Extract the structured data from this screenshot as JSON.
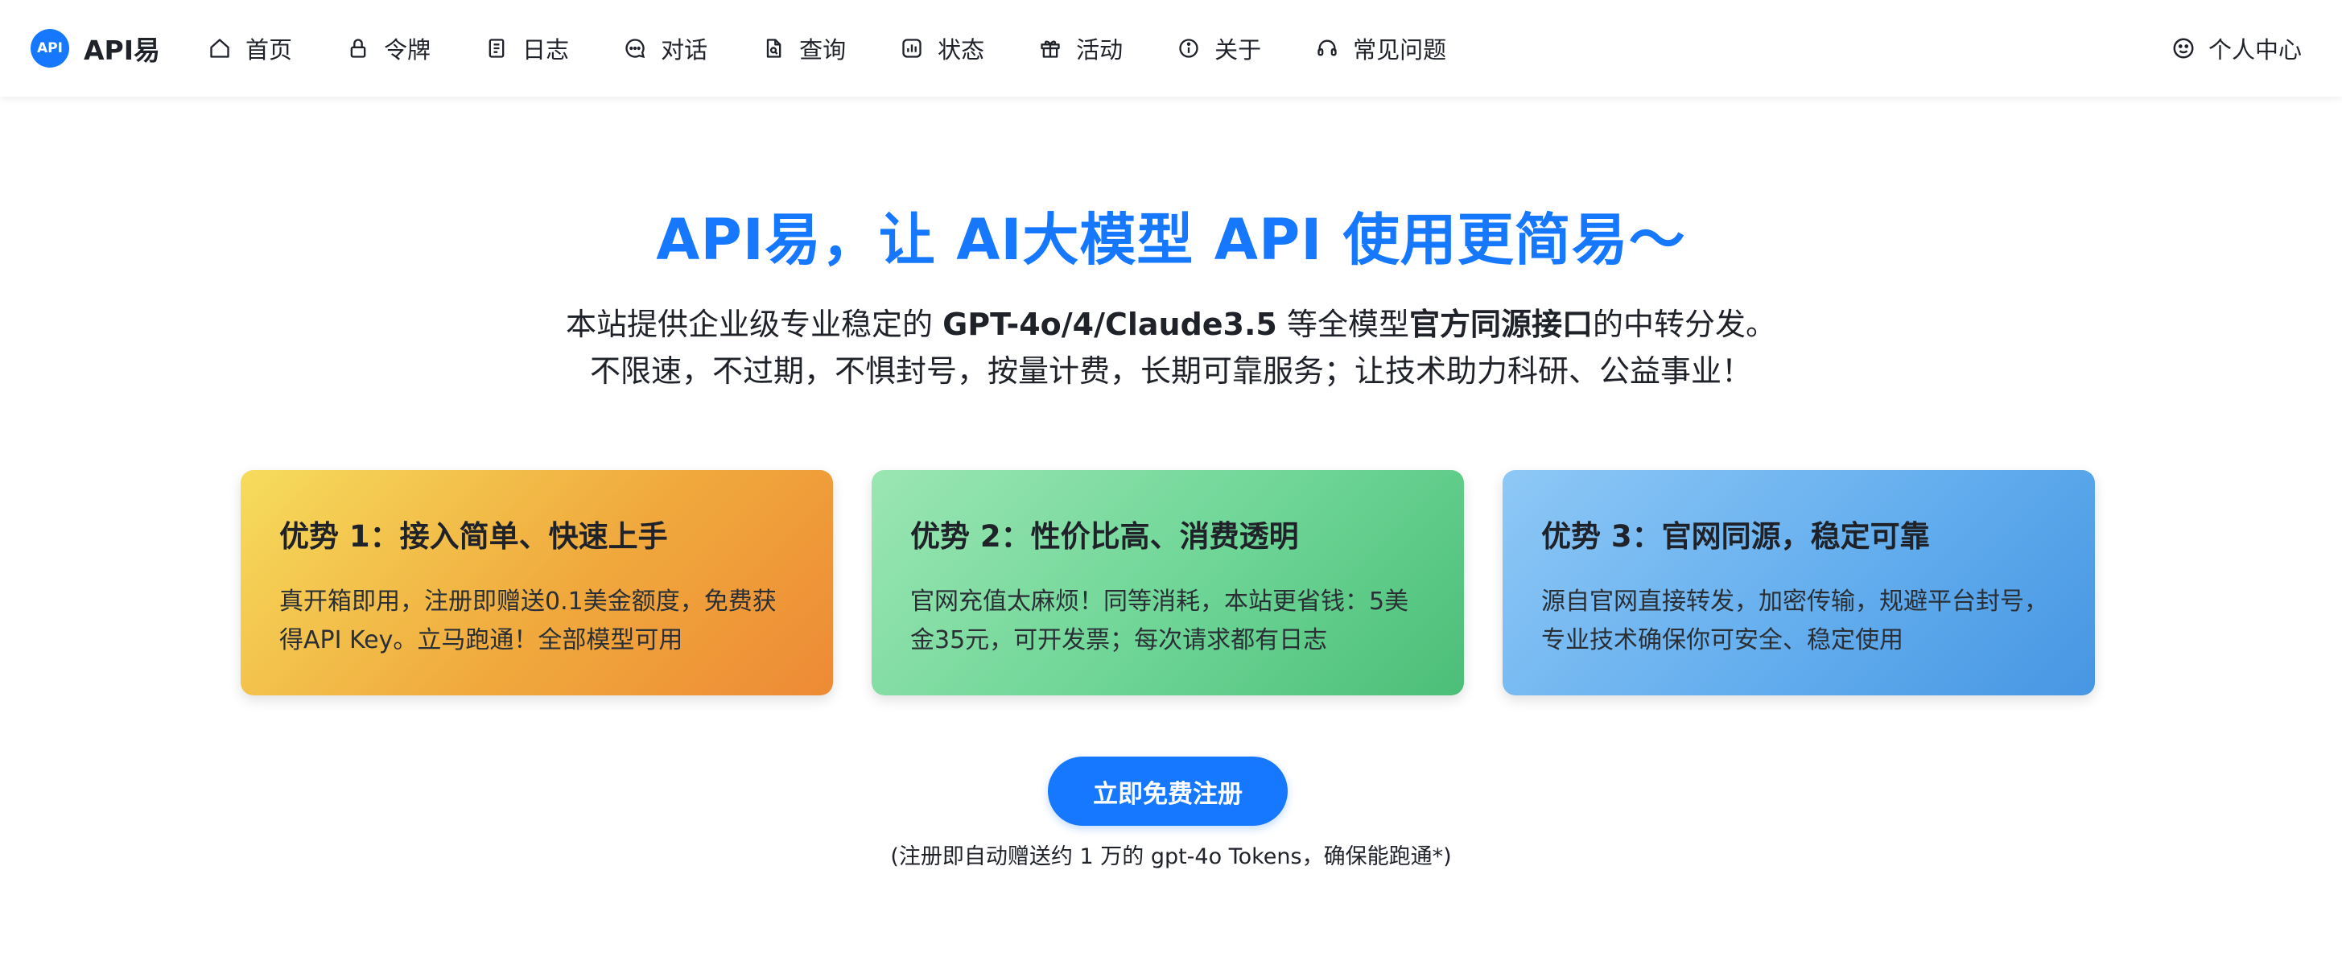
{
  "header": {
    "logo_text": "API",
    "brand_name": "API易",
    "nav": [
      {
        "label": "首页",
        "icon": "home-icon"
      },
      {
        "label": "令牌",
        "icon": "lock-icon"
      },
      {
        "label": "日志",
        "icon": "document-icon"
      },
      {
        "label": "对话",
        "icon": "chat-bubble-icon"
      },
      {
        "label": "查询",
        "icon": "file-search-icon"
      },
      {
        "label": "状态",
        "icon": "status-chart-icon"
      },
      {
        "label": "活动",
        "icon": "gift-icon"
      },
      {
        "label": "关于",
        "icon": "info-icon"
      },
      {
        "label": "常见问题",
        "icon": "headset-icon"
      }
    ],
    "user_center": "个人中心",
    "user_icon": "smile-face-icon"
  },
  "hero": {
    "title": "API易，让 AI大模型 API 使用更简易～",
    "line1_a": "本站提供企业级专业稳定的 ",
    "line1_b": "GPT-4o/4/Claude3.5",
    "line1_c": " 等全模型",
    "line1_d": "官方同源接口",
    "line1_e": "的中转分发。",
    "line2": "不限速，不过期，不惧封号，按量计费，长期可靠服务；让技术助力科研、公益事业！"
  },
  "cards": [
    {
      "title": "优势 1：接入简单、快速上手",
      "text": "真开箱即用，注册即赠送0.1美金额度，免费获得API Key。立马跑通！全部模型可用"
    },
    {
      "title": "优势 2：性价比高、消费透明",
      "text": "官网充值太麻烦！同等消耗，本站更省钱：5美金35元，可开发票；每次请求都有日志"
    },
    {
      "title": "优势 3：官网同源，稳定可靠",
      "text": "源自官网直接转发，加密传输，规避平台封号，专业技术确保你可安全、稳定使用"
    }
  ],
  "cta": {
    "label": "立即免费注册",
    "note": "(注册即自动赠送约 1 万的 gpt-4o Tokens，确保能跑通*)"
  },
  "colors": {
    "accent": "#1677ff",
    "card_yellow": "#f0a93d",
    "card_green": "#6dd596",
    "card_blue": "#64aeee"
  }
}
